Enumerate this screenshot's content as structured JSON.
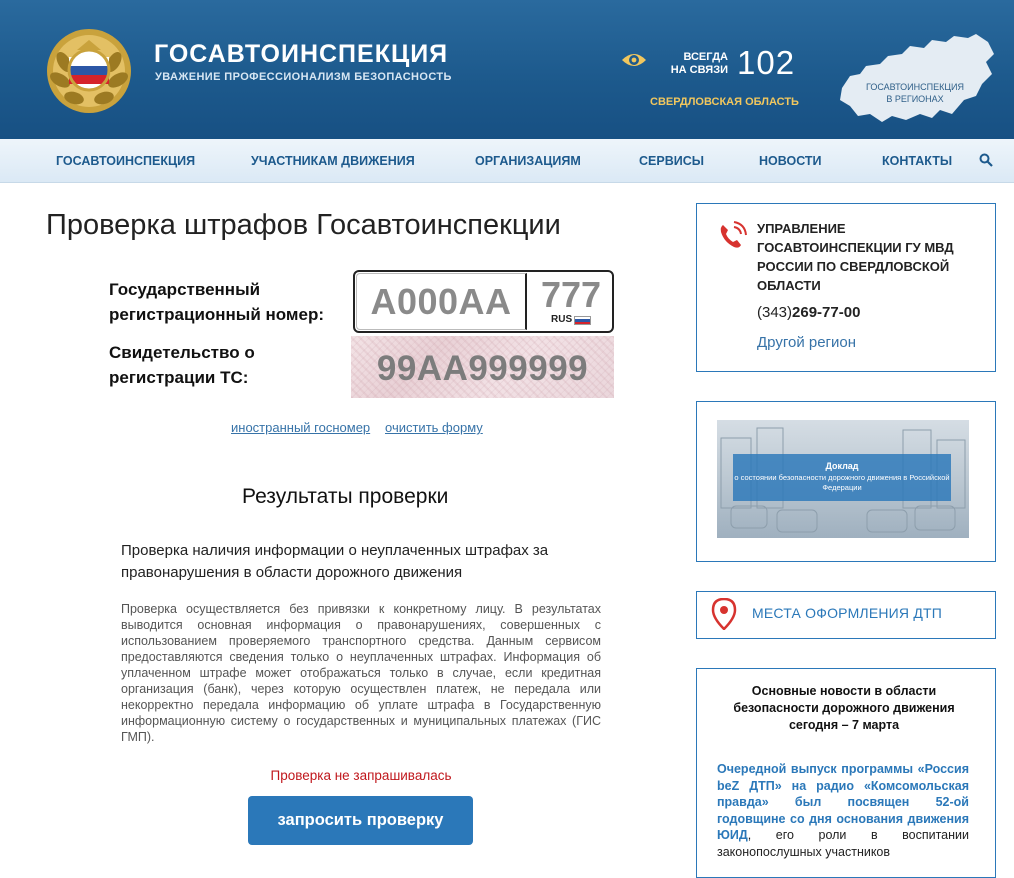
{
  "header": {
    "title": "ГОСАВТОИНСПЕКЦИЯ",
    "slogan": "УВАЖЕНИЕ ПРОФЕССИОНАЛИЗМ БЕЗОПАСНОСТЬ",
    "always_line1": "ВСЕГДА",
    "always_line2": "НА СВЯЗИ",
    "hotline": "102",
    "region": "СВЕРДЛОВСКАЯ ОБЛАСТЬ",
    "map_line1": "ГОСАВТОИНСПЕКЦИЯ",
    "map_line2": "В РЕГИОНАХ"
  },
  "nav": {
    "items": [
      "ГОСАВТОИНСПЕКЦИЯ",
      "УЧАСТНИКАМ ДВИЖЕНИЯ",
      "ОРГАНИЗАЦИЯМ",
      "СЕРВИСЫ",
      "НОВОСТИ",
      "КОНТАКТЫ"
    ]
  },
  "main": {
    "title": "Проверка штрафов Госавтоинспекции",
    "plate_label_1": "Государственный",
    "plate_label_2": "регистрационный номер:",
    "plate_main": "А000АА",
    "plate_region": "777",
    "plate_country": "RUS",
    "cert_label_1": "Свидетельство о",
    "cert_label_2": "регистрации ТС:",
    "cert_placeholder": "99АА999999",
    "link_foreign": "иностранный госномер",
    "link_clear": "очистить форму",
    "results_title": "Результаты проверки",
    "check_title": "Проверка наличия информации о неуплаченных штрафах за правонарушения в области дорожного движения",
    "check_desc": "Проверка осуществляется без привязки к конкретному лицу. В результатах выводится основная информация о правонарушениях, совершенных с использованием проверяемого транспортного средства. Данным сервисом предоставляются сведения только о неуплаченных штрафах. Информация об уплаченном штрафе может отображаться только в случае, если кредитная организация (банк), через которую осуществлен платеж, не передала или некорректно передала информацию об уплате штрафа в Государственную информационную систему о государственных и муниципальных платежах (ГИС ГМП).",
    "status": "Проверка не запрашивалась",
    "button": "запросить проверку"
  },
  "sidebar": {
    "contact_org": "УПРАВЛЕНИЕ ГОСАВТОИНСПЕКЦИИ ГУ МВД РОССИИ ПО СВЕРДЛОВСКОЙ ОБЛАСТИ",
    "phone_code": "(343)",
    "phone_number": "269-77-00",
    "other_region": "Другой регион",
    "report_head": "Доклад",
    "report_sub": "о состоянии безопасности дорожного движения в Российской Федерации",
    "dtp": "МЕСТА ОФОРМЛЕНИЯ ДТП",
    "news_head": "Основные новости в области безопасности дорожного движения сегодня – 7 марта",
    "news_bold": "Очередной выпуск программы «Россия beZ ДТП» на радио «Комсомольская правда» был посвящен 52-ой годовщине со дня основания движения ЮИД",
    "news_rest": ", его роли в воспитании законопослушных участников"
  },
  "colors": {
    "header_blue": "#1d5a8d",
    "accent_blue": "#2b78b9",
    "link_blue": "#3773a8",
    "gold": "#f1c75e",
    "status_red": "#c0171c"
  }
}
